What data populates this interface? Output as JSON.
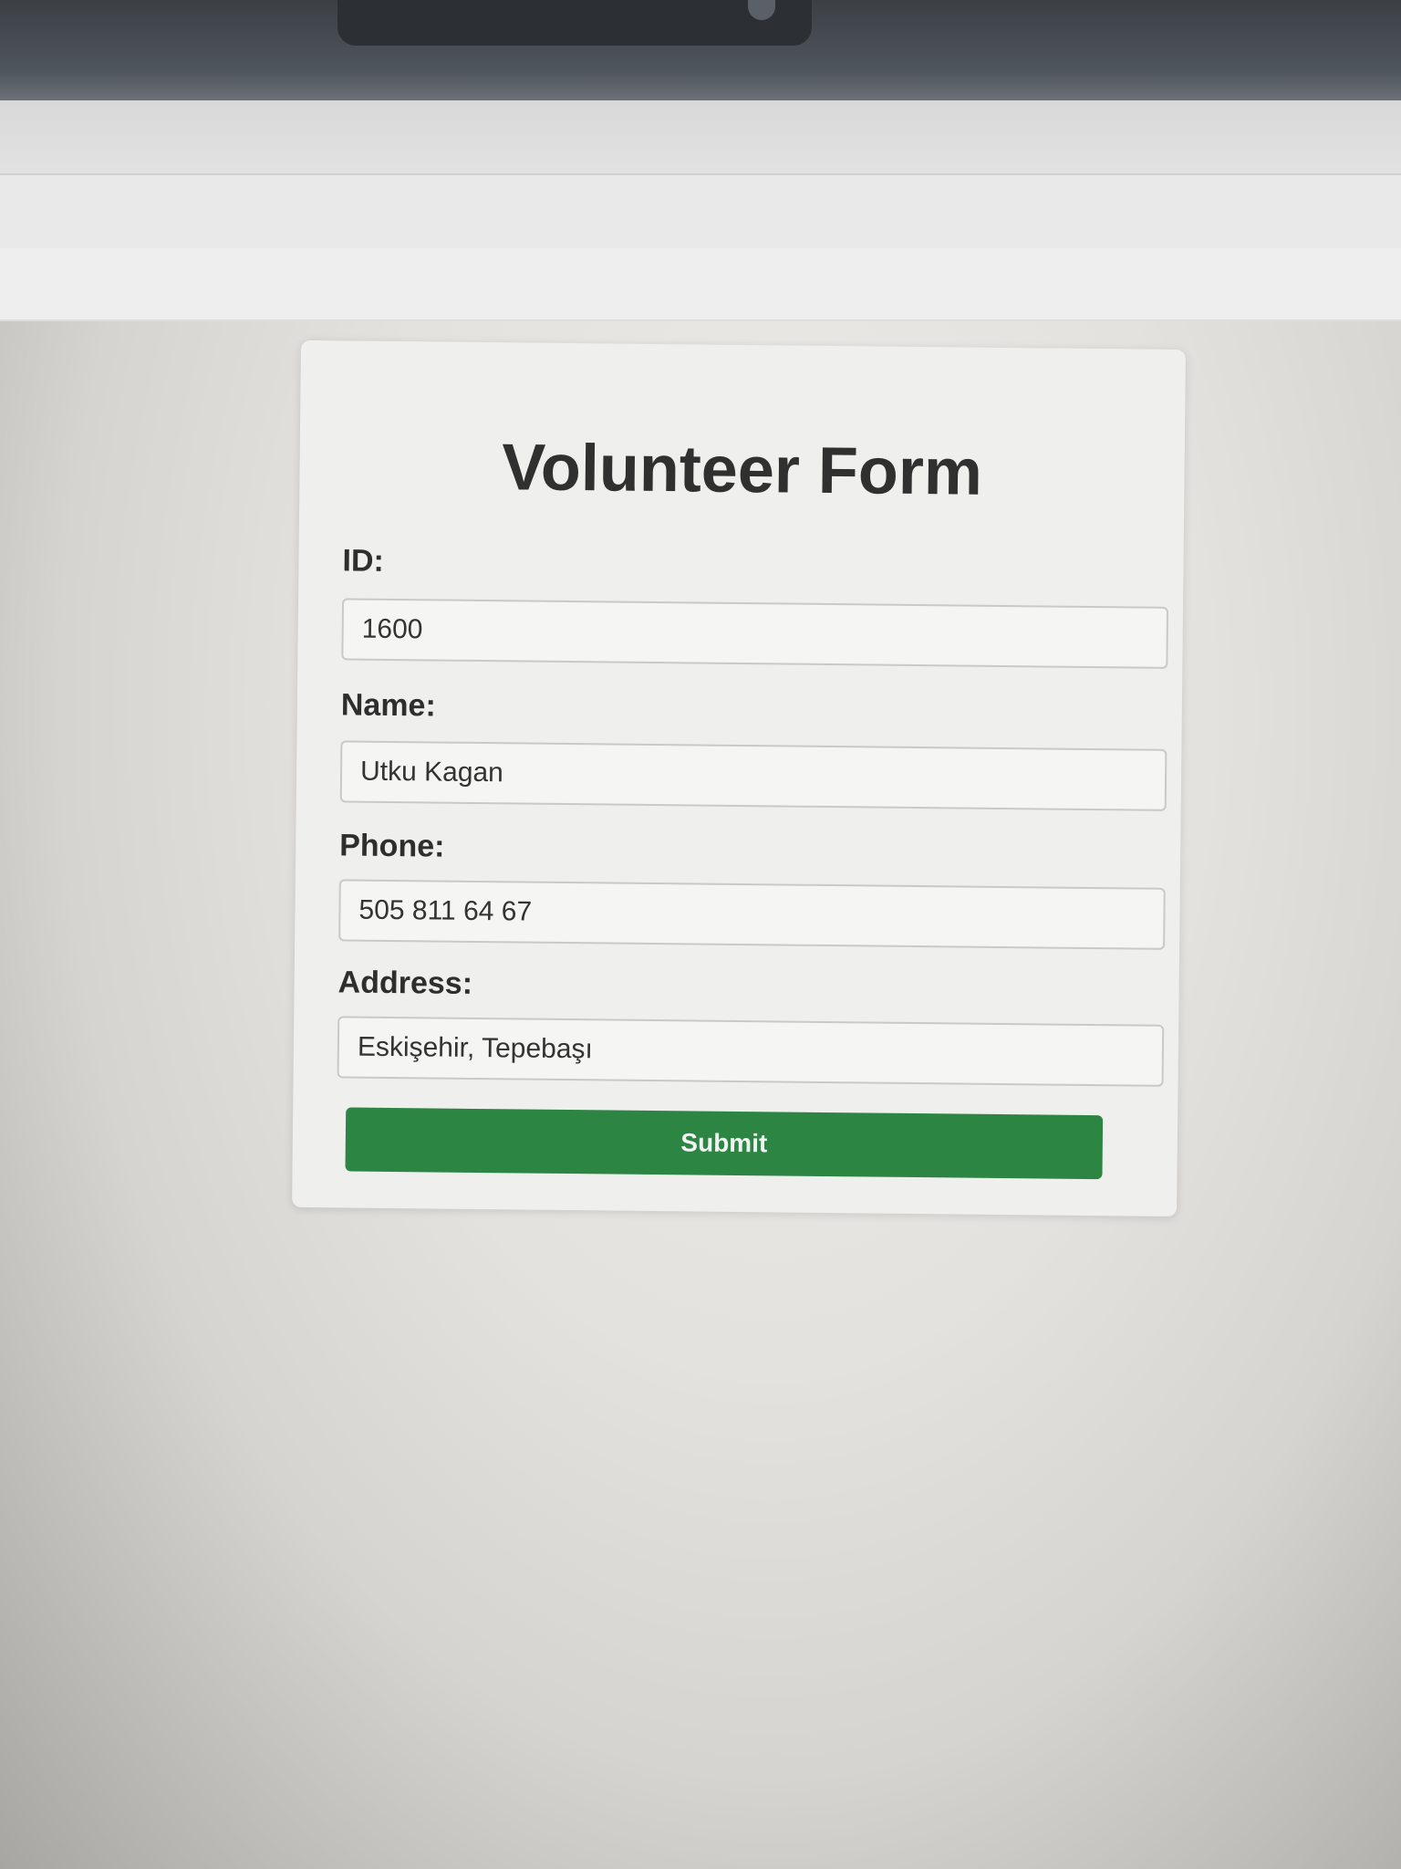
{
  "form": {
    "title": "Volunteer Form",
    "fields": [
      {
        "label": "ID:",
        "value": "1600"
      },
      {
        "label": "Name:",
        "value": "Utku Kagan"
      },
      {
        "label": "Phone:",
        "value": "505 811 64 67"
      },
      {
        "label": "Address:",
        "value": "Eskişehir, Tepebaşı"
      }
    ],
    "submit_label": "Submit"
  },
  "colors": {
    "submit_button": "#2c8543",
    "card_background": "#efefed",
    "title_text": "#303030"
  }
}
